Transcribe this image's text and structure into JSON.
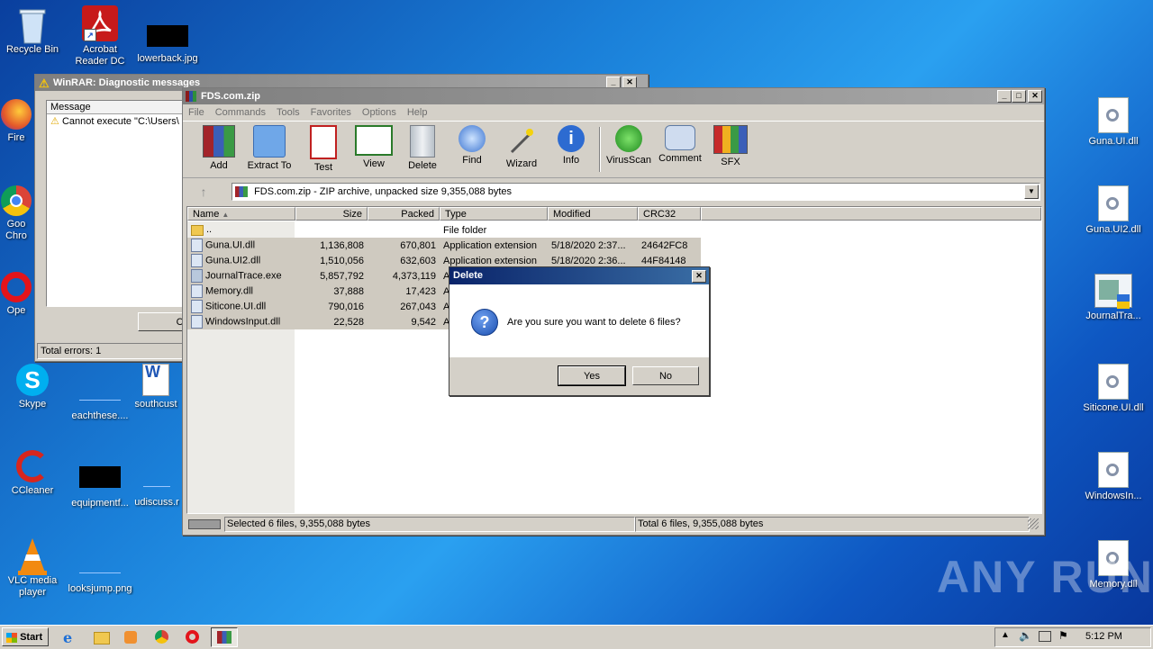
{
  "desktop": {
    "left_icons": [
      {
        "name": "recycle-bin",
        "label": "Recycle Bin"
      },
      {
        "name": "acrobat-reader",
        "label": "Acrobat Reader DC"
      },
      {
        "name": "lowerback-file",
        "label": "lowerback.jpg"
      },
      {
        "name": "firefox",
        "label": "Fire"
      },
      {
        "name": "google-chrome",
        "label": "Goo Chro"
      },
      {
        "name": "opera",
        "label": "Ope"
      },
      {
        "name": "skype",
        "label": "Skype"
      },
      {
        "name": "eachthese-file",
        "label": "eachthese...."
      },
      {
        "name": "southcust-file",
        "label": "southcust"
      },
      {
        "name": "ccleaner",
        "label": "CCleaner"
      },
      {
        "name": "equipmentf-file",
        "label": "equipmentf..."
      },
      {
        "name": "udiscuss-file",
        "label": "udiscuss.r"
      },
      {
        "name": "vlc-player",
        "label": "VLC media player"
      },
      {
        "name": "looksjump-file",
        "label": "looksjump.png"
      }
    ],
    "right_icons": [
      {
        "name": "guna-ui-dll",
        "label": "Guna.UI.dll"
      },
      {
        "name": "guna-ui2-dll",
        "label": "Guna.UI2.dll"
      },
      {
        "name": "journaltrace-exe",
        "label": "JournalTra..."
      },
      {
        "name": "siticone-ui-dll",
        "label": "Siticone.UI.dll"
      },
      {
        "name": "windowsinput-dll",
        "label": "WindowsIn..."
      },
      {
        "name": "memory-dll",
        "label": "Memory.dll"
      }
    ]
  },
  "diag": {
    "title": "WinRAR: Diagnostic messages",
    "col_message": "Message",
    "message": "Cannot execute \"C:\\Users\\",
    "close_btn": "Cl",
    "total_errors": "Total errors: 1"
  },
  "winrar": {
    "title": "FDS.com.zip",
    "menu": [
      "File",
      "Commands",
      "Tools",
      "Favorites",
      "Options",
      "Help"
    ],
    "tools": [
      "Add",
      "Extract To",
      "Test",
      "View",
      "Delete",
      "Find",
      "Wizard",
      "Info",
      "VirusScan",
      "Comment",
      "SFX"
    ],
    "address": "FDS.com.zip - ZIP archive, unpacked size 9,355,088 bytes",
    "columns": [
      "Name",
      "Size",
      "Packed",
      "Type",
      "Modified",
      "CRC32"
    ],
    "rows": [
      {
        "name": "..",
        "size": "",
        "packed": "",
        "type": "File folder",
        "modified": "",
        "crc": ""
      },
      {
        "name": "Guna.UI.dll",
        "size": "1,136,808",
        "packed": "670,801",
        "type": "Application extension",
        "modified": "5/18/2020 2:37...",
        "crc": "24642FC8"
      },
      {
        "name": "Guna.UI2.dll",
        "size": "1,510,056",
        "packed": "632,603",
        "type": "Application extension",
        "modified": "5/18/2020 2:36...",
        "crc": "44F84148"
      },
      {
        "name": "JournalTrace.exe",
        "size": "5,857,792",
        "packed": "4,373,119",
        "type": "A",
        "modified": "",
        "crc": ""
      },
      {
        "name": "Memory.dll",
        "size": "37,888",
        "packed": "17,423",
        "type": "A",
        "modified": "",
        "crc": ""
      },
      {
        "name": "Siticone.UI.dll",
        "size": "790,016",
        "packed": "267,043",
        "type": "A",
        "modified": "",
        "crc": ""
      },
      {
        "name": "WindowsInput.dll",
        "size": "22,528",
        "packed": "9,542",
        "type": "A",
        "modified": "",
        "crc": ""
      }
    ],
    "status_left": "Selected 6 files, 9,355,088 bytes",
    "status_right": "Total 6 files, 9,355,088 bytes"
  },
  "dialog": {
    "title": "Delete",
    "message": "Are you sure you want to delete 6 files?",
    "yes": "Yes",
    "no": "No"
  },
  "taskbar": {
    "start": "Start",
    "clock": "5:12 PM"
  },
  "watermark": "ANY RUN"
}
